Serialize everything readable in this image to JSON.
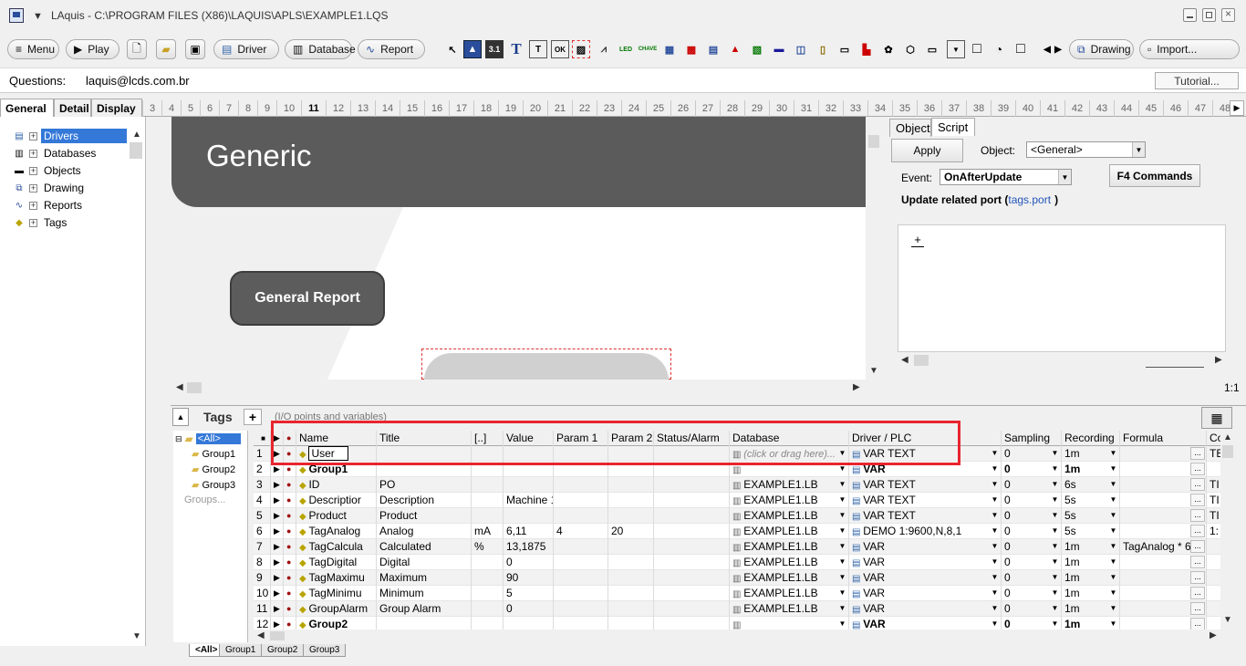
{
  "window": {
    "title": "LAquis - C:\\PROGRAM FILES (X86)\\LAQUIS\\APLS\\EXAMPLE1.LQS"
  },
  "toolbar": {
    "menu": "Menu",
    "play": "Play",
    "driver": "Driver",
    "database": "Database",
    "report": "Report",
    "drawing": "Drawing",
    "import": "Import...",
    "icon_labels": {
      "text_T": "T",
      "text_small_T": "T",
      "led": "LED",
      "chave": "CHAVE",
      "disp": "3.1"
    }
  },
  "questions": {
    "label": "Questions:",
    "email": "laquis@lcds.com.br",
    "tutorial": "Tutorial..."
  },
  "tabs": {
    "main": [
      "General",
      "Detail",
      "Display"
    ],
    "numbers": [
      "3",
      "4",
      "5",
      "6",
      "7",
      "8",
      "9",
      "10",
      "11",
      "12",
      "13",
      "14",
      "15",
      "16",
      "17",
      "18",
      "19",
      "20",
      "21",
      "22",
      "23",
      "24",
      "25",
      "26",
      "27",
      "28",
      "29",
      "30",
      "31",
      "32",
      "33",
      "34",
      "35",
      "36",
      "37",
      "38",
      "39",
      "40",
      "41",
      "42",
      "43",
      "44",
      "45",
      "46",
      "47",
      "48"
    ],
    "selected_number": "11"
  },
  "tree": {
    "items": [
      "Drivers",
      "Databases",
      "Objects",
      "Drawing",
      "Reports",
      "Tags"
    ],
    "selected": "Drivers"
  },
  "canvas": {
    "header_text": "Generic",
    "button_text": "General Report"
  },
  "right_panel": {
    "tabs": [
      "Object",
      "Script"
    ],
    "apply": "Apply",
    "object_label": "Object:",
    "object_value": "<General>",
    "event_label": "Event:",
    "event_value": "OnAfterUpdate",
    "f4": "F4 Commands",
    "update_text": "Update related port (",
    "update_link": "tags.port",
    "update_close": ")",
    "script_plus": "+",
    "ratio": "1:1"
  },
  "tags": {
    "title": "Tags",
    "plus": "+",
    "subtitle": "(I/O points and variables)",
    "tree": [
      "<All>",
      "Group1",
      "Group2",
      "Group3",
      "Groups..."
    ],
    "columns": [
      "Name",
      "Title",
      "[..]",
      "Value",
      "Param 1",
      "Param 2",
      "Status/Alarm",
      "Database",
      "Driver / PLC",
      "Sampling",
      "Recording",
      "Formula",
      "Co"
    ],
    "rows": [
      {
        "n": "1",
        "name": "User",
        "title": "",
        "unit": "",
        "value": "",
        "p1": "",
        "p2": "",
        "db": "(click or drag here)...",
        "driver": "VAR TEXT",
        "samp": "0",
        "rec": "1m",
        "formula": "",
        "co": "TE"
      },
      {
        "n": "2",
        "name": "Group1",
        "title": "",
        "unit": "",
        "value": "",
        "p1": "",
        "p2": "",
        "db": "",
        "driver": "VAR",
        "samp": "0",
        "rec": "1m",
        "formula": "",
        "co": ""
      },
      {
        "n": "3",
        "name": "ID",
        "title": "PO",
        "unit": "",
        "value": "",
        "p1": "",
        "p2": "",
        "db": "EXAMPLE1.LB",
        "driver": "VAR TEXT",
        "samp": "0",
        "rec": "6s",
        "formula": "",
        "co": "TI"
      },
      {
        "n": "4",
        "name": "Descriptior",
        "title": "Description",
        "unit": "",
        "value": "Machine 1",
        "p1": "",
        "p2": "",
        "db": "EXAMPLE1.LB",
        "driver": "VAR TEXT",
        "samp": "0",
        "rec": "5s",
        "formula": "",
        "co": "TI"
      },
      {
        "n": "5",
        "name": "Product",
        "title": "Product",
        "unit": "",
        "value": "",
        "p1": "",
        "p2": "",
        "db": "EXAMPLE1.LB",
        "driver": "VAR TEXT",
        "samp": "0",
        "rec": "5s",
        "formula": "",
        "co": "TI"
      },
      {
        "n": "6",
        "name": "TagAnalog",
        "title": "Analog",
        "unit": "mA",
        "value": "6,11",
        "p1": "4",
        "p2": "20",
        "db": "EXAMPLE1.LB",
        "driver": "DEMO 1:9600,N,8,1",
        "samp": "0",
        "rec": "5s",
        "formula": "",
        "co": "1:"
      },
      {
        "n": "7",
        "name": "TagCalcula",
        "title": "Calculated",
        "unit": "%",
        "value": "13,1875",
        "p1": "",
        "p2": "",
        "db": "EXAMPLE1.LB",
        "driver": "VAR",
        "samp": "0",
        "rec": "1m",
        "formula": "TagAnalog * 6.",
        "co": ""
      },
      {
        "n": "8",
        "name": "TagDigital",
        "title": "Digital",
        "unit": "",
        "value": "0",
        "p1": "",
        "p2": "",
        "db": "EXAMPLE1.LB",
        "driver": "VAR",
        "samp": "0",
        "rec": "1m",
        "formula": "",
        "co": ""
      },
      {
        "n": "9",
        "name": "TagMaximu",
        "title": "Maximum",
        "unit": "",
        "value": "90",
        "p1": "",
        "p2": "",
        "db": "EXAMPLE1.LB",
        "driver": "VAR",
        "samp": "0",
        "rec": "1m",
        "formula": "",
        "co": ""
      },
      {
        "n": "10",
        "name": "TagMinimu",
        "title": "Minimum",
        "unit": "",
        "value": "5",
        "p1": "",
        "p2": "",
        "db": "EXAMPLE1.LB",
        "driver": "VAR",
        "samp": "0",
        "rec": "1m",
        "formula": "",
        "co": ""
      },
      {
        "n": "11",
        "name": "GroupAlarm",
        "title": "Group Alarm",
        "unit": "",
        "value": "0",
        "p1": "",
        "p2": "",
        "db": "EXAMPLE1.LB",
        "driver": "VAR",
        "samp": "0",
        "rec": "1m",
        "formula": "",
        "co": ""
      },
      {
        "n": "12",
        "name": "Group2",
        "title": "",
        "unit": "",
        "value": "",
        "p1": "",
        "p2": "",
        "db": "",
        "driver": "VAR",
        "samp": "0",
        "rec": "1m",
        "formula": "",
        "co": ""
      }
    ],
    "bottom_tabs": [
      "<All>",
      "Group1",
      "Group2",
      "Group3"
    ]
  },
  "colors": {
    "highlight": "#e8252f",
    "selection": "#3478d8",
    "panel_dark": "#5b5b5b"
  }
}
